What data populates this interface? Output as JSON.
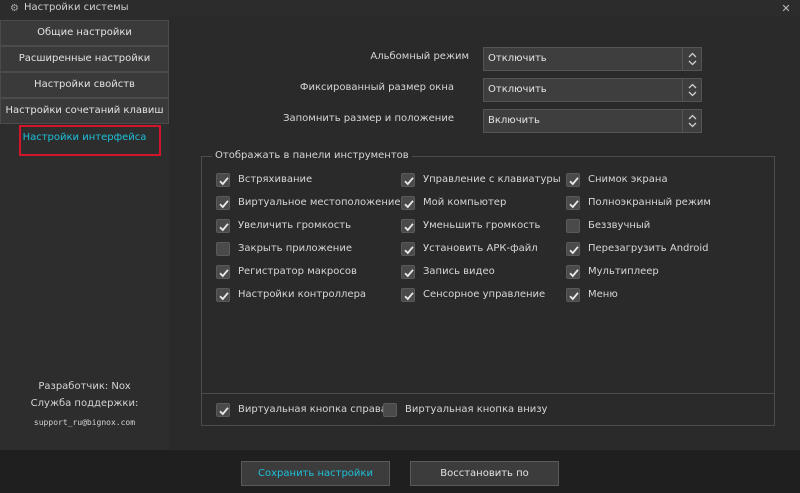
{
  "window": {
    "title": "Настройки системы",
    "close_glyph": "✕",
    "icon": "gear-icon"
  },
  "sidebar": {
    "items": [
      {
        "label": "Общие настройки"
      },
      {
        "label": "Расширенные настройки"
      },
      {
        "label": "Настройки свойств"
      },
      {
        "label": "Настройки сочетаний клавиш"
      },
      {
        "label": "Настройки интерфейса"
      }
    ],
    "developer": "Разработчик: Nox",
    "support_label": "Служба поддержки:",
    "support_email": "support_ru@bignox.com"
  },
  "form": {
    "landscape": {
      "label": "Альбомный режим",
      "value": "Отключить"
    },
    "fixed_size": {
      "label": "Фиксированный размер окна",
      "value": "Отключить"
    },
    "remember": {
      "label": "Запомнить размер и положение",
      "value": "Включить"
    }
  },
  "toolbar_group": {
    "legend": "Отображать в панели инструментов",
    "items": [
      {
        "label": "Встряхивание",
        "checked": true
      },
      {
        "label": "Управление с клавиатуры",
        "checked": true
      },
      {
        "label": "Снимок экрана",
        "checked": true
      },
      {
        "label": "Виртуальное местоположение",
        "checked": true
      },
      {
        "label": "Мой компьютер",
        "checked": true
      },
      {
        "label": "Полноэкранный режим",
        "checked": true
      },
      {
        "label": "Увеличить громкость",
        "checked": true
      },
      {
        "label": "Уменьшить громкость",
        "checked": true
      },
      {
        "label": "Беззвучный",
        "checked": false
      },
      {
        "label": "Закрыть приложение",
        "checked": false
      },
      {
        "label": "Установить АРК-файл",
        "checked": true
      },
      {
        "label": "Перезагрузить Android",
        "checked": true
      },
      {
        "label": "Регистратор макросов",
        "checked": true
      },
      {
        "label": "Запись видео",
        "checked": true
      },
      {
        "label": "Мультиплеер",
        "checked": true
      },
      {
        "label": "Настройки контроллера",
        "checked": true
      },
      {
        "label": "Сенсорное управление",
        "checked": true
      },
      {
        "label": "Меню",
        "checked": true
      }
    ],
    "bottom": [
      {
        "label": "Виртуальная кнопка справа",
        "checked": true
      },
      {
        "label": "Виртуальная кнопка внизу",
        "checked": false
      }
    ]
  },
  "footer": {
    "save_label": "Сохранить настройки",
    "reset_label": "Восстановить по умолчанию"
  },
  "colors": {
    "accent": "#1ec0d9",
    "highlight": "#d2152b",
    "background": "#2a2a2a"
  }
}
